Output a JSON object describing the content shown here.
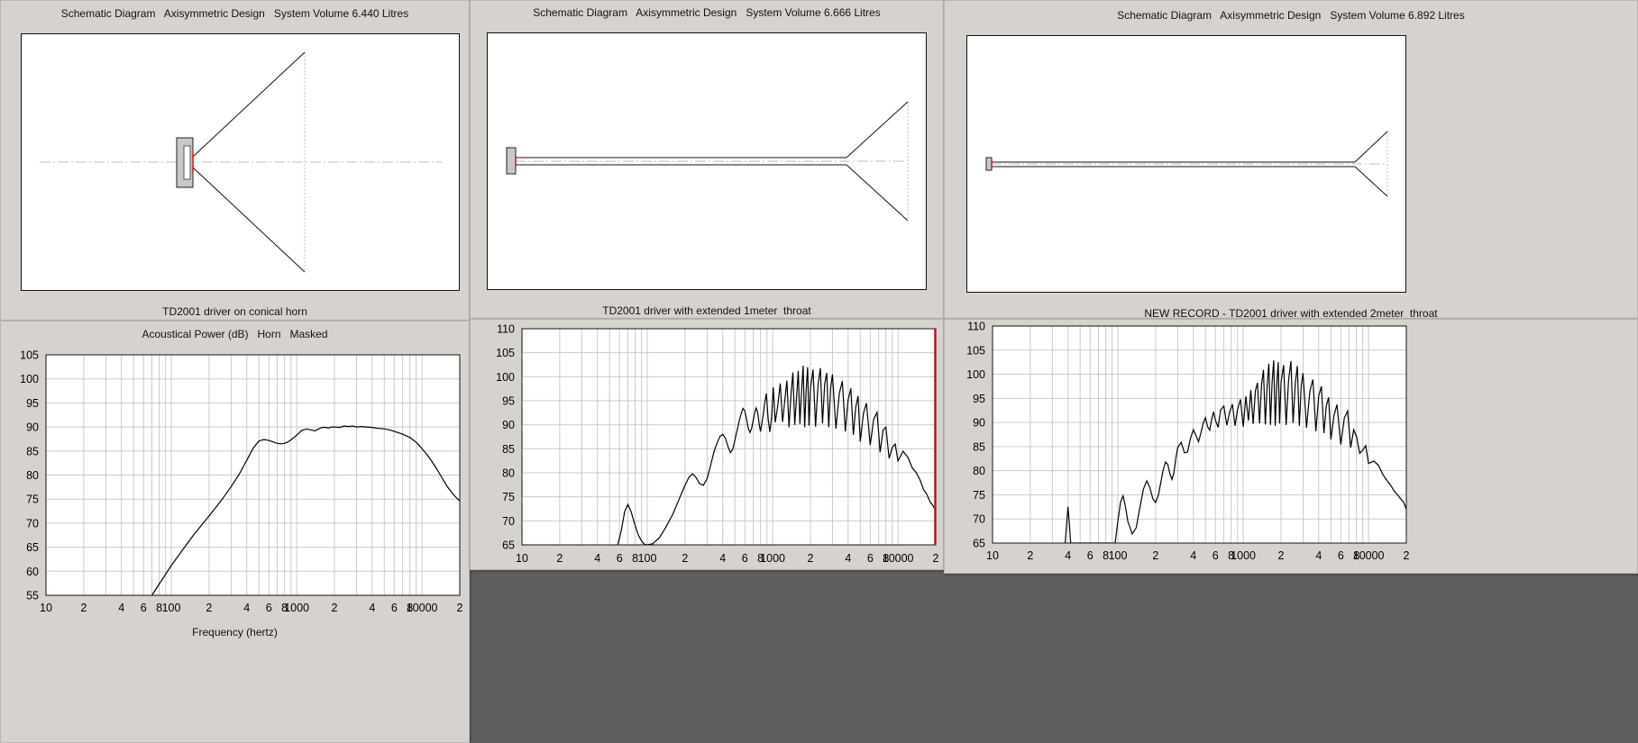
{
  "schematics": [
    {
      "title": "Schematic Diagram   Axisymmetric Design   System Volume 6.440 Litres",
      "caption": "TD2001 driver on conical horn"
    },
    {
      "title": "Schematic Diagram   Axisymmetric Design   System Volume 6.666 Litres",
      "caption": "TD2001 driver with extended 1meter  throat"
    },
    {
      "title": "Schematic Diagram   Axisymmetric Design   System Volume 6.892 Litres",
      "caption": "NEW RECORD - TD2001 driver with extended 2meter  throat"
    }
  ],
  "plot_header": "Acoustical Power (dB)   Horn   Masked",
  "plot_footer": "Frequency (hertz)",
  "x_tick_labels": [
    "10",
    "2",
    "4",
    "6",
    "8",
    "100",
    "2",
    "4",
    "6",
    "8",
    "1000",
    "2",
    "4",
    "6",
    "8",
    "10000",
    "2"
  ],
  "colors": {
    "trace": "#000000",
    "grid": "#c9c9c9",
    "frame": "#111111",
    "marker": "#e01010",
    "window": "#d6d3ce",
    "desktop": "#5f5f5f"
  },
  "chart_data": [
    {
      "type": "line",
      "title": "Acoustical Power (dB)   Horn   Masked",
      "xlabel": "Frequency (hertz)",
      "ylabel": "",
      "xscale": "log",
      "xlim": [
        10,
        20000
      ],
      "ylim": [
        55,
        105
      ],
      "yticks": [
        55,
        60,
        65,
        70,
        75,
        80,
        85,
        90,
        95,
        100,
        105
      ],
      "grid": true,
      "series": [
        {
          "x": [
            70,
            100,
            150,
            200,
            250,
            300,
            350,
            400,
            450,
            500,
            550,
            600,
            650,
            700,
            750,
            800,
            850,
            900,
            950,
            1000,
            1100,
            1200,
            1300,
            1400,
            1500,
            1600,
            1700,
            1800,
            1900,
            2000,
            2200,
            2400,
            2600,
            2800,
            3000,
            3300,
            3600,
            4000,
            4500,
            5000,
            5500,
            6000,
            7000,
            8000,
            9000,
            10000,
            11000,
            12000,
            13000,
            14000,
            15000,
            16000,
            18000,
            20000
          ],
          "y": [
            55,
            61.2,
            67.5,
            71.5,
            74.7,
            77.6,
            80.3,
            83.1,
            85.6,
            87.1,
            87.4,
            87.2,
            86.9,
            86.6,
            86.5,
            86.6,
            86.9,
            87.3,
            87.8,
            88.3,
            89.3,
            89.6,
            89.4,
            89.2,
            89.6,
            89.9,
            89.9,
            89.8,
            90.0,
            90.0,
            89.9,
            90.2,
            90.1,
            90.2,
            90.0,
            90.1,
            90.0,
            89.9,
            89.7,
            89.6,
            89.4,
            89.1,
            88.5,
            87.8,
            86.8,
            85.5,
            84.2,
            82.8,
            81.4,
            80.0,
            78.7,
            77.5,
            75.8,
            74.6
          ]
        }
      ]
    },
    {
      "type": "line",
      "title": "",
      "xlabel": "",
      "ylabel": "",
      "xscale": "log",
      "xlim": [
        10,
        20000
      ],
      "ylim": [
        65,
        110
      ],
      "yticks": [
        65,
        70,
        75,
        80,
        85,
        90,
        95,
        100,
        105,
        110
      ],
      "grid": true,
      "series": [
        {
          "x": [
            58,
            62,
            66,
            70,
            74,
            80,
            85,
            90,
            95,
            100,
            110,
            125,
            140,
            160,
            180,
            200,
            215,
            230,
            245,
            260,
            280,
            300,
            320,
            340,
            360,
            380,
            400,
            420,
            440,
            460,
            480,
            500,
            520,
            540,
            560,
            580,
            600,
            620,
            640,
            660,
            680,
            700,
            720,
            740,
            760,
            780,
            800,
            830,
            860,
            890,
            920,
            950,
            980,
            1010,
            1050,
            1100,
            1150,
            1200,
            1250,
            1300,
            1350,
            1400,
            1450,
            1500,
            1550,
            1600,
            1650,
            1700,
            1750,
            1800,
            1850,
            1900,
            1950,
            2000,
            2100,
            2200,
            2300,
            2400,
            2500,
            2600,
            2700,
            2800,
            2900,
            3000,
            3200,
            3400,
            3600,
            3800,
            4000,
            4200,
            4400,
            4600,
            4800,
            5000,
            5300,
            5600,
            6000,
            6400,
            6800,
            7200,
            7600,
            8000,
            8500,
            9000,
            9500,
            10000,
            11000,
            12000,
            13000,
            14000,
            15000,
            16000,
            17000,
            18000,
            19000,
            20000
          ],
          "y": [
            65,
            68,
            72,
            73.4,
            72,
            69,
            67,
            65.8,
            65.1,
            65,
            65.2,
            66.5,
            68.6,
            71.4,
            74.6,
            77.4,
            79.1,
            79.8,
            79.0,
            77.8,
            77.4,
            78.8,
            81.6,
            84.3,
            86.2,
            87.6,
            88.0,
            87.2,
            85.5,
            84.2,
            84.9,
            86.8,
            88.8,
            90.7,
            92.3,
            93.4,
            92.9,
            91.1,
            89.2,
            88.4,
            89.3,
            91.0,
            92.6,
            93.5,
            92.5,
            90.2,
            88.6,
            91.0,
            94.2,
            96.5,
            91.2,
            88.5,
            91.5,
            97.8,
            90.5,
            94.2,
            98.6,
            90.6,
            95.1,
            99.2,
            89.5,
            96.1,
            100.9,
            90.0,
            95.6,
            101.2,
            90.2,
            96.8,
            102.3,
            89.5,
            97.0,
            102.0,
            89.8,
            97.5,
            101.5,
            89.6,
            98.2,
            101.8,
            90.3,
            98.5,
            100.8,
            89.5,
            97.6,
            100.5,
            89.2,
            96.5,
            99.1,
            88.6,
            95.2,
            97.6,
            87.9,
            93.6,
            96.0,
            86.5,
            92.4,
            94.5,
            85.8,
            91.2,
            92.6,
            84.3,
            88.9,
            89.5,
            83.0,
            85.3,
            86.0,
            82.5,
            84.5,
            83.2,
            81.0,
            80.0,
            78.5,
            76.5,
            75.5,
            74.0,
            73.2,
            72.0
          ]
        }
      ]
    },
    {
      "type": "line",
      "title": "",
      "xlabel": "",
      "ylabel": "",
      "xscale": "log",
      "xlim": [
        10,
        20000
      ],
      "ylim": [
        65,
        110
      ],
      "yticks": [
        65,
        70,
        75,
        80,
        85,
        90,
        95,
        100,
        105,
        110
      ],
      "grid": true,
      "series": [
        {
          "x": [
            38,
            39,
            40,
            41,
            42,
            95,
            100,
            105,
            110,
            115,
            120,
            130,
            140,
            150,
            160,
            170,
            180,
            190,
            200,
            210,
            220,
            230,
            240,
            250,
            260,
            270,
            280,
            290,
            300,
            320,
            340,
            360,
            380,
            400,
            420,
            440,
            460,
            480,
            500,
            520,
            540,
            560,
            580,
            600,
            630,
            660,
            700,
            740,
            780,
            820,
            860,
            900,
            950,
            1000,
            1050,
            1100,
            1150,
            1200,
            1250,
            1300,
            1350,
            1400,
            1450,
            1500,
            1550,
            1600,
            1650,
            1700,
            1750,
            1800,
            1850,
            1900,
            1950,
            2000,
            2100,
            2200,
            2300,
            2400,
            2500,
            2600,
            2700,
            2800,
            2900,
            3000,
            3200,
            3400,
            3600,
            3800,
            4000,
            4200,
            4400,
            4600,
            4800,
            5000,
            5300,
            5600,
            6000,
            6400,
            6800,
            7200,
            7600,
            8000,
            8500,
            9000,
            9500,
            10000,
            11000,
            12000,
            13000,
            14000,
            15000,
            16000,
            17000,
            18000,
            19000,
            20000
          ],
          "y": [
            65,
            69,
            72.5,
            69,
            65,
            65,
            69.5,
            73.5,
            74.8,
            72.5,
            69.5,
            66.9,
            68.2,
            72.4,
            76.2,
            77.9,
            76.5,
            74.2,
            73.4,
            74.9,
            77.6,
            80.2,
            81.8,
            81.3,
            79.4,
            78.2,
            79.6,
            82.5,
            84.8,
            85.9,
            83.7,
            83.9,
            86.8,
            88.5,
            87.3,
            86.0,
            87.9,
            89.9,
            91.0,
            89.1,
            88.4,
            90.7,
            92.2,
            90.5,
            89.0,
            92.6,
            93.4,
            89.4,
            92.2,
            93.8,
            89.3,
            92.6,
            94.8,
            89.1,
            95.4,
            90.4,
            96.7,
            89.7,
            96.6,
            98.2,
            89.8,
            97.8,
            100.9,
            89.6,
            97.6,
            102.2,
            89.5,
            98.3,
            102.9,
            89.3,
            97.5,
            102.5,
            89.8,
            98.3,
            101.9,
            89.5,
            98.8,
            102.7,
            89.9,
            98.0,
            101.7,
            89.3,
            97.5,
            100.2,
            88.9,
            96.5,
            98.9,
            88.2,
            95.5,
            97.5,
            87.8,
            93.4,
            95.2,
            86.5,
            91.5,
            93.7,
            85.4,
            90.9,
            92.4,
            84.8,
            88.5,
            87.1,
            83.6,
            84.3,
            85.2,
            81.5,
            82.0,
            81.1,
            79.2,
            78.0,
            77.0,
            75.8,
            75.0,
            74.2,
            73.5,
            72.0
          ]
        }
      ]
    }
  ]
}
